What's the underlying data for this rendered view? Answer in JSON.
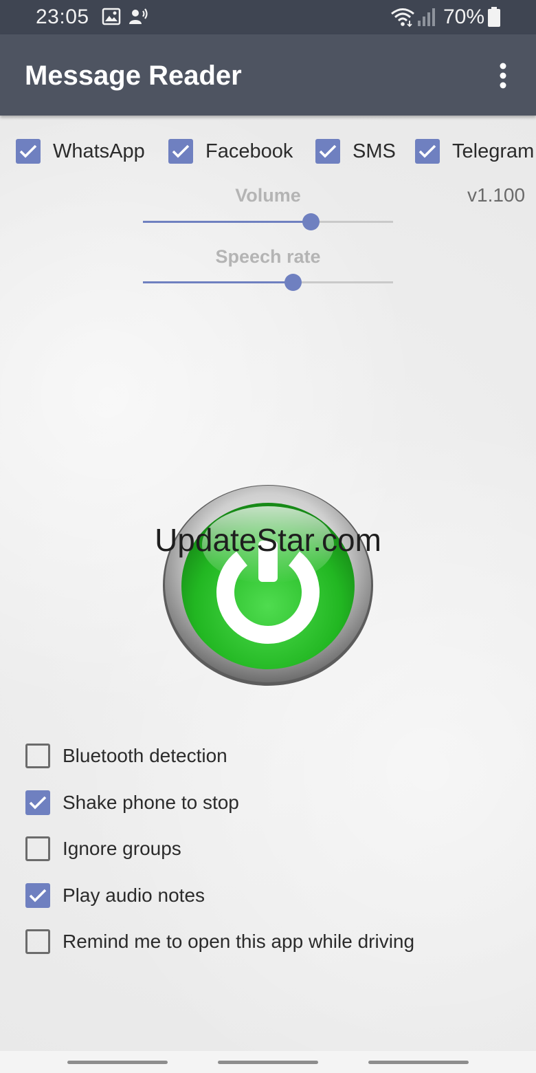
{
  "status_bar": {
    "time": "23:05",
    "battery": "70%",
    "icons": [
      "image-icon",
      "voice-assistant-icon",
      "wifi-icon",
      "signal-icon",
      "battery-icon"
    ]
  },
  "app_bar": {
    "title": "Message Reader",
    "menu_icon": "more-vert-icon"
  },
  "sources": [
    {
      "label": "WhatsApp",
      "checked": true
    },
    {
      "label": "Facebook",
      "checked": true
    },
    {
      "label": "SMS",
      "checked": true
    },
    {
      "label": "Telegram",
      "checked": true
    }
  ],
  "version": "v1.100",
  "sliders": {
    "volume": {
      "label": "Volume",
      "fraction": 0.67
    },
    "speech_rate": {
      "label": "Speech rate",
      "fraction": 0.6
    }
  },
  "power_button": {
    "icon": "power-icon",
    "state": "on",
    "color": "#2fc42f"
  },
  "watermark": "UpdateStar.com",
  "options": [
    {
      "label": "Bluetooth detection",
      "checked": false
    },
    {
      "label": "Shake phone to stop",
      "checked": true
    },
    {
      "label": "Ignore groups",
      "checked": false
    },
    {
      "label": "Play audio notes",
      "checked": true
    },
    {
      "label": "Remind me to open this app while driving",
      "checked": false
    }
  ],
  "colors": {
    "accent": "#6f80c0",
    "app_bar": "#4e5461",
    "status_bar": "#3f4552"
  }
}
